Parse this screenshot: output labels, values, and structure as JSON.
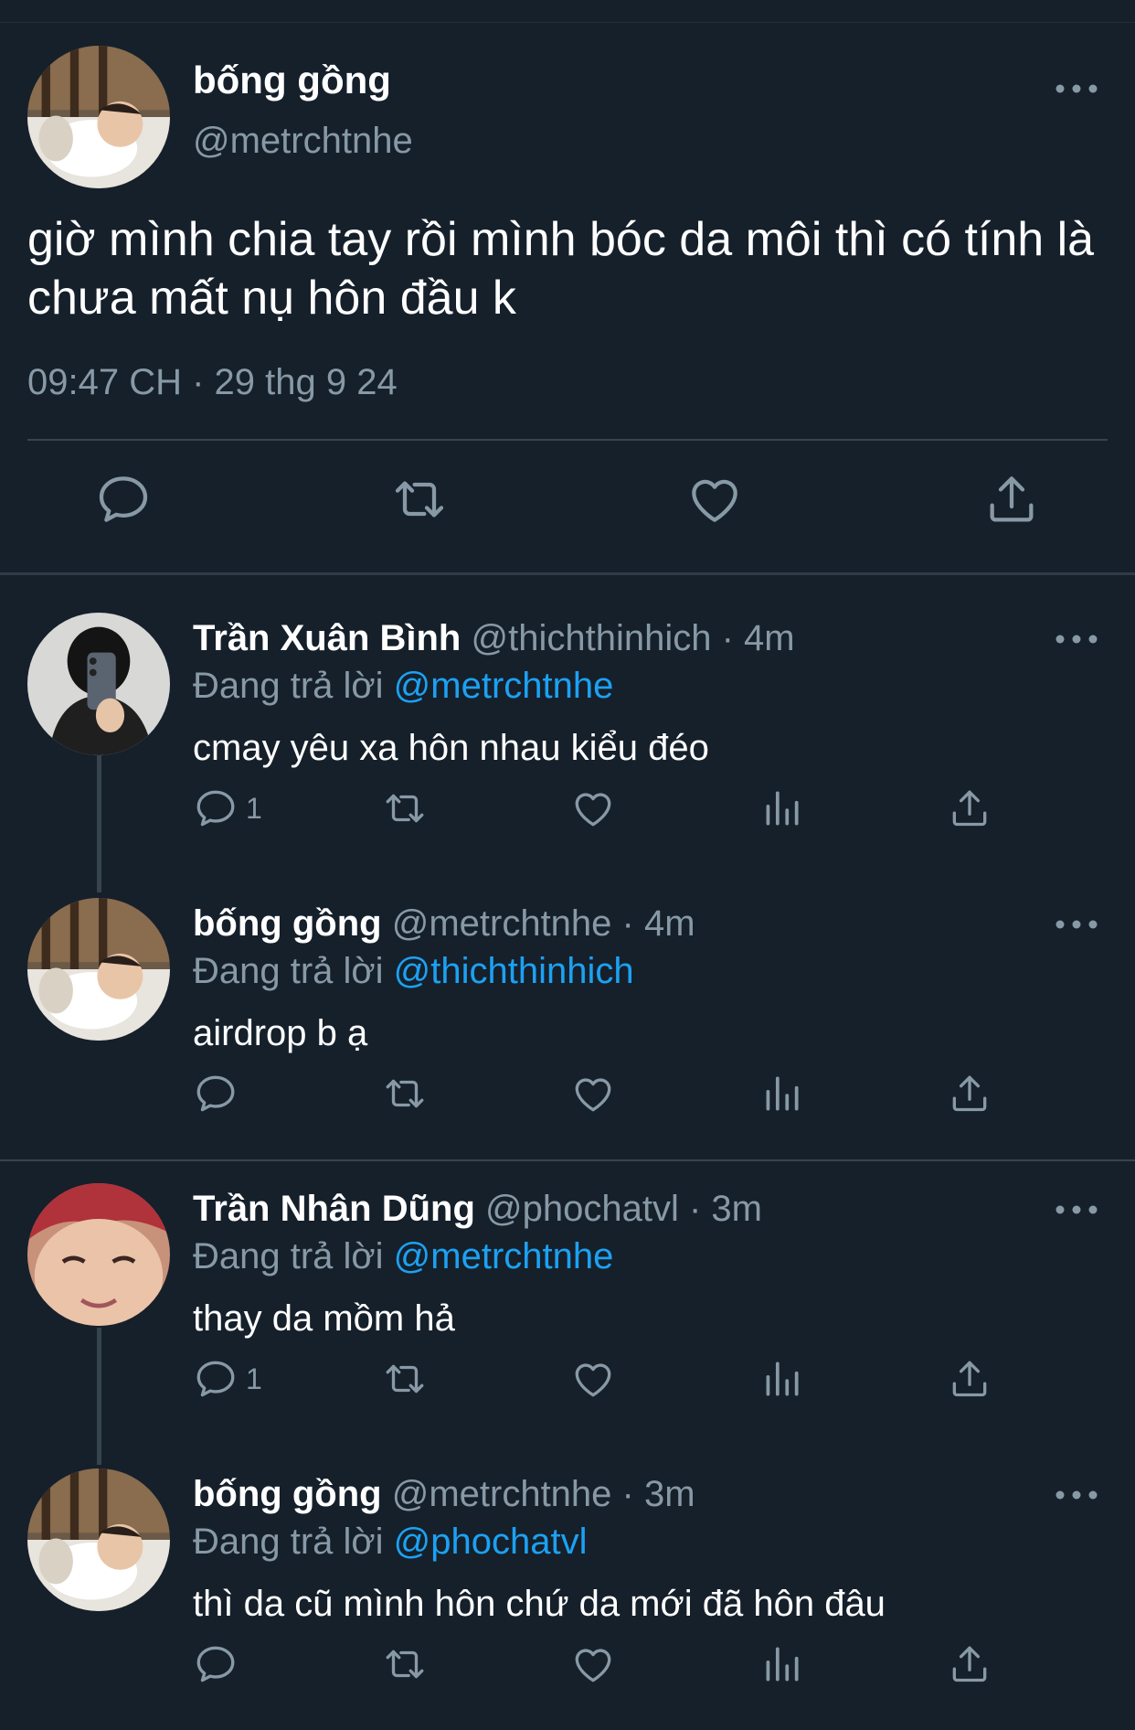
{
  "main_tweet": {
    "display_name": "bống gồng",
    "handle": "@metrchtnhe",
    "text": "giờ mình chia tay rồi mình bóc da môi thì có tính là chưa mất nụ hôn đầu k",
    "timestamp": "09:47 CH · 29 thg 9 24",
    "actions": [
      "reply-icon",
      "retweet-icon",
      "like-icon",
      "share-icon"
    ]
  },
  "replies": [
    {
      "display_name": "Trần Xuân Bình",
      "handle_time": "@thichthinhich · 4m",
      "replying_prefix": "Đang trả lời",
      "replying_to": "@metrchtnhe",
      "text": "cmay yêu xa hôn nhau kiểu đéo",
      "reply_count": "1"
    },
    {
      "display_name": "bống gồng",
      "handle_time": "@metrchtnhe · 4m",
      "replying_prefix": "Đang trả lời",
      "replying_to": "@thichthinhich",
      "text": "airdrop b ạ",
      "reply_count": ""
    },
    {
      "display_name": "Trần Nhân Dũng",
      "handle_time": "@phochatvl · 3m",
      "replying_prefix": "Đang trả lời",
      "replying_to": "@metrchtnhe",
      "text": "thay da mồm hả",
      "reply_count": "1"
    },
    {
      "display_name": "bống gồng",
      "handle_time": "@metrchtnhe · 3m",
      "replying_prefix": "Đang trả lời",
      "replying_to": "@phochatvl",
      "text": "thì da cũ mình hôn chứ da mới đã hôn đâu",
      "reply_count": ""
    }
  ],
  "colors": {
    "background": "#15202b",
    "secondary_text": "#8899a6",
    "mention": "#1da1f2",
    "divider": "#38444d"
  }
}
